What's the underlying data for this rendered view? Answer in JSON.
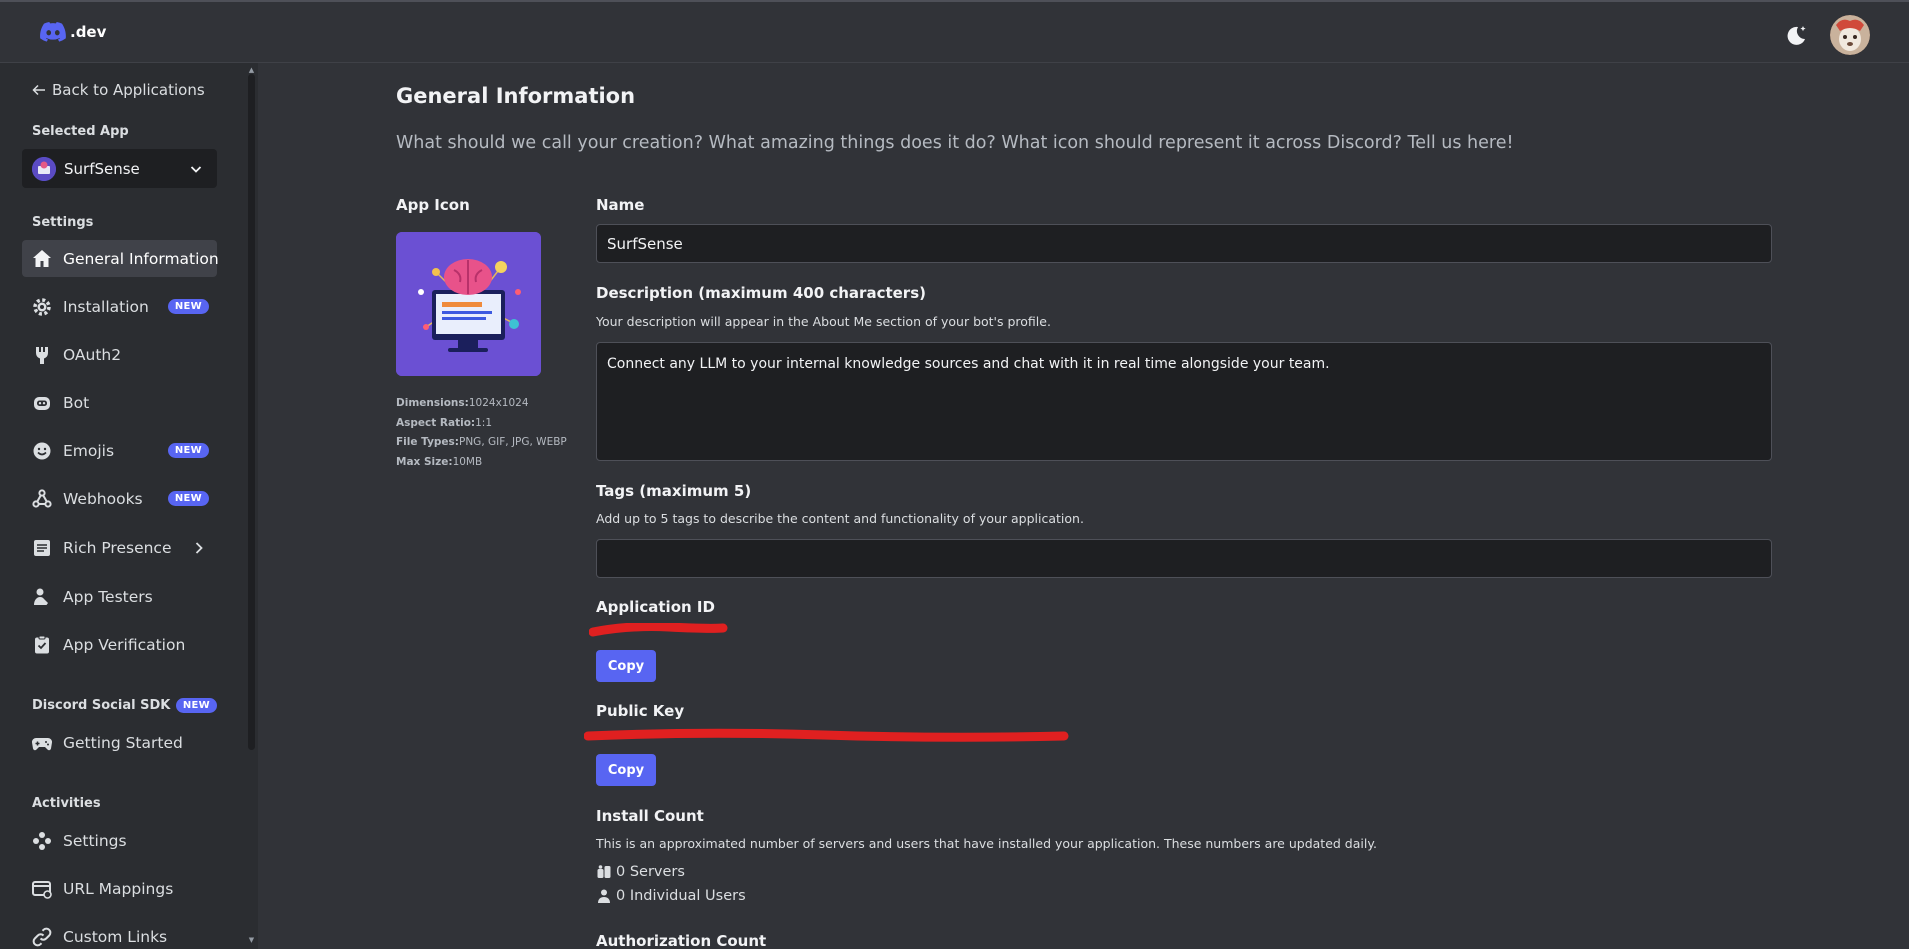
{
  "header": {
    "logo_text": ".dev",
    "theme_toggle_icon": "moon-icon",
    "avatar_icon": "user-avatar"
  },
  "sidebar": {
    "back_label": "Back to Applications",
    "selected_app_heading": "Selected App",
    "selected_app_name": "SurfSense",
    "settings_heading": "Settings",
    "settings_items": [
      {
        "label": "General Information",
        "icon": "home-icon",
        "badge": ""
      },
      {
        "label": "Installation",
        "icon": "gear-icon",
        "badge": "NEW"
      },
      {
        "label": "OAuth2",
        "icon": "wrench-icon",
        "badge": ""
      },
      {
        "label": "Bot",
        "icon": "robot-icon",
        "badge": ""
      },
      {
        "label": "Emojis",
        "icon": "smiley-icon",
        "badge": "NEW"
      },
      {
        "label": "Webhooks",
        "icon": "webhook-icon",
        "badge": "NEW"
      },
      {
        "label": "Rich Presence",
        "icon": "document-icon",
        "badge": ""
      },
      {
        "label": "App Testers",
        "icon": "person-icon",
        "badge": ""
      },
      {
        "label": "App Verification",
        "icon": "clipboard-check-icon",
        "badge": ""
      }
    ],
    "social_sdk_heading": "Discord Social SDK",
    "social_sdk_badge": "NEW",
    "social_sdk_items": [
      {
        "label": "Getting Started",
        "icon": "gamepad-icon"
      }
    ],
    "activities_heading": "Activities",
    "activities_items": [
      {
        "label": "Settings",
        "icon": "activity-icon"
      },
      {
        "label": "URL Mappings",
        "icon": "url-mapping-icon"
      },
      {
        "label": "Custom Links",
        "icon": "link-icon"
      }
    ]
  },
  "main": {
    "title": "General Information",
    "subtitle": "What should we call your creation? What amazing things does it do? What icon should represent it across Discord? Tell us here!",
    "app_icon_label": "App Icon",
    "icon_meta": {
      "dimensions_label": "Dimensions:",
      "dimensions_value": "1024x1024",
      "aspect_label": "Aspect Ratio:",
      "aspect_value": "1:1",
      "filetypes_label": "File Types:",
      "filetypes_value": "PNG, GIF, JPG, WEBP",
      "maxsize_label": "Max Size:",
      "maxsize_value": "10MB"
    },
    "name_label": "Name",
    "name_value": "SurfSense",
    "description_label": "Description (maximum 400 characters)",
    "description_help": "Your description will appear in the About Me section of your bot's profile.",
    "description_value": "Connect any LLM to your internal knowledge sources and chat with it in real time alongside your team.",
    "tags_label": "Tags (maximum 5)",
    "tags_help": "Add up to 5 tags to describe the content and functionality of your application.",
    "tags_value": "",
    "app_id_label": "Application ID",
    "copy_label": "Copy",
    "public_key_label": "Public Key",
    "install_count_label": "Install Count",
    "install_count_help": "This is an approximated number of servers and users that have installed your application. These numbers are updated daily.",
    "servers_text": "0 Servers",
    "users_text": "0 Individual Users",
    "auth_count_label": "Authorization Count"
  },
  "colors": {
    "background": "#313338",
    "sidebar": "#2b2d31",
    "accent": "#5865f2",
    "redaction": "#e02020"
  }
}
